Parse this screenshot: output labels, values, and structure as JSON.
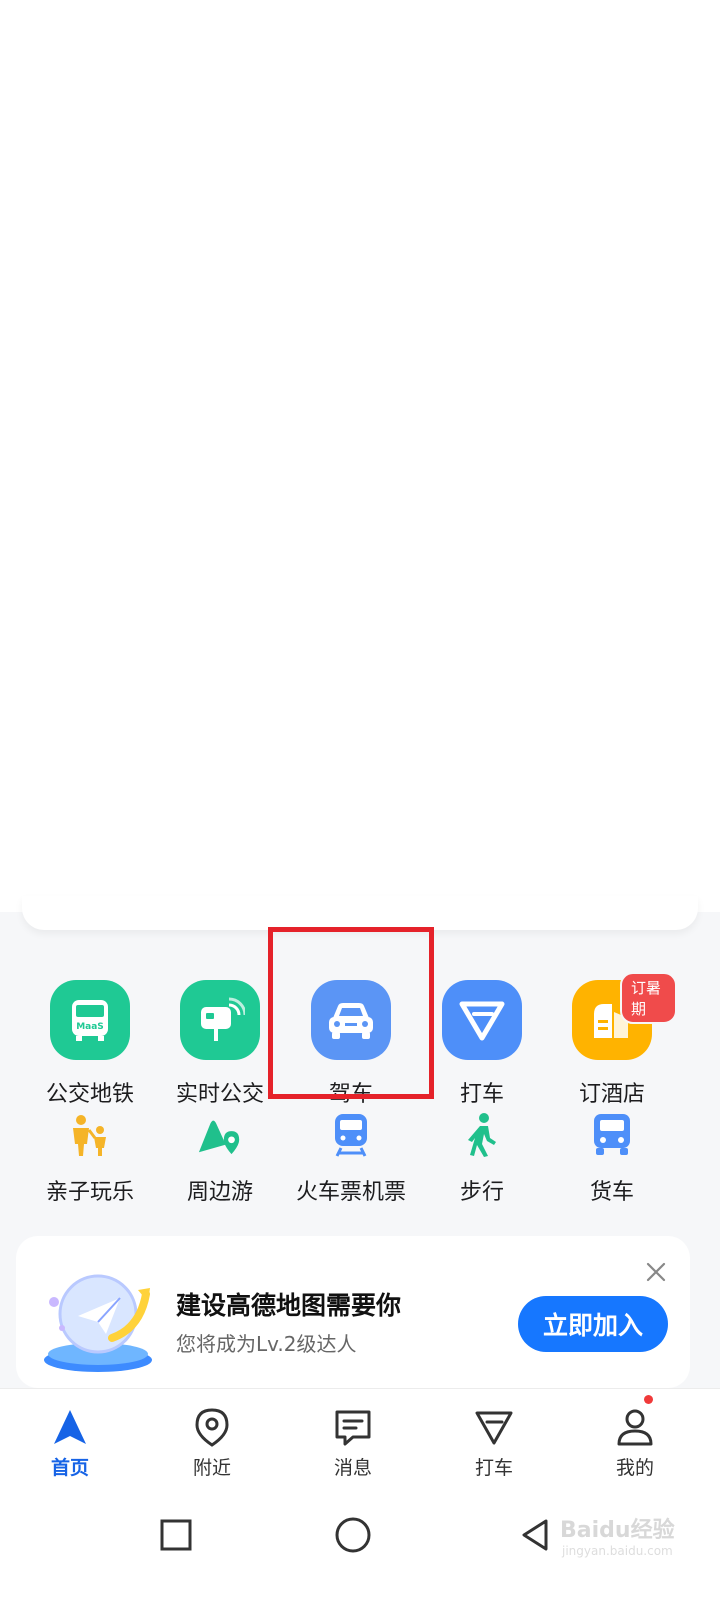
{
  "main_services": [
    {
      "label": "公交地铁",
      "icon": "bus-icon",
      "color": "#1fc994"
    },
    {
      "label": "实时公交",
      "icon": "bus-stop-icon",
      "color": "#1fc994"
    },
    {
      "label": "驾车",
      "icon": "car-icon",
      "color": "#5b95f5"
    },
    {
      "label": "打车",
      "icon": "taxi-icon",
      "color": "#4e8ff9"
    },
    {
      "label": "订酒店",
      "icon": "hotel-icon",
      "color": "#ffb300",
      "badge": "订暑期"
    }
  ],
  "bus_icon_text": "MaaS",
  "secondary_services": [
    {
      "label": "亲子玩乐",
      "icon": "family-icon",
      "color": "#f5b428"
    },
    {
      "label": "周边游",
      "icon": "mountain-pin-icon",
      "color": "#20c08c"
    },
    {
      "label": "火车票机票",
      "icon": "train-icon",
      "color": "#4e8ff9"
    },
    {
      "label": "步行",
      "icon": "walking-icon",
      "color": "#20c08c"
    },
    {
      "label": "货车",
      "icon": "truck-icon",
      "color": "#4e8ff9"
    }
  ],
  "promo": {
    "title": "建设高德地图需要你",
    "subtitle": "您将成为Lv.2级达人",
    "button": "立即加入"
  },
  "tabs": [
    {
      "label": "首页",
      "icon": "navigation-arrow-icon",
      "active": true
    },
    {
      "label": "附近",
      "icon": "location-pin-icon"
    },
    {
      "label": "消息",
      "icon": "message-icon"
    },
    {
      "label": "打车",
      "icon": "taxi-icon"
    },
    {
      "label": "我的",
      "icon": "user-icon",
      "dot": true
    }
  ],
  "highlight_color": "#e5222a",
  "accent_color": "#1677ff",
  "watermark": {
    "text": "Baidu经验",
    "sub": "jingyan.baidu.com"
  }
}
